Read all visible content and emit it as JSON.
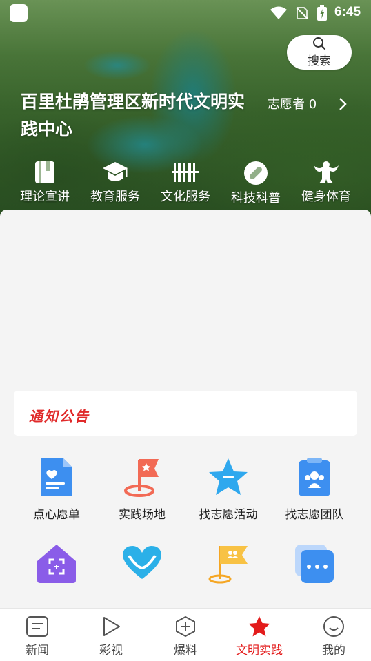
{
  "status_bar": {
    "time": "6:45"
  },
  "header": {
    "search_label": "搜索",
    "title": "百里杜鹃管理区新时代文明实践中心",
    "volunteer": "志愿者 0"
  },
  "categories": [
    {
      "label": "理论宣讲",
      "icon": "book-icon"
    },
    {
      "label": "教育服务",
      "icon": "graduation-cap-icon"
    },
    {
      "label": "文化服务",
      "icon": "barcode-icon"
    },
    {
      "label": "科技科普",
      "icon": "science-icon"
    },
    {
      "label": "健身体育",
      "icon": "fitness-icon"
    }
  ],
  "notice": {
    "title": "通知公告"
  },
  "services": [
    {
      "label": "点心愿单",
      "icon": "wish-list-icon"
    },
    {
      "label": "实践场地",
      "icon": "location-flag-icon"
    },
    {
      "label": "找志愿活动",
      "icon": "star-activity-icon"
    },
    {
      "label": "找志愿团队",
      "icon": "team-icon"
    },
    {
      "label": "",
      "icon": "home-scan-icon"
    },
    {
      "label": "",
      "icon": "heart-icon"
    },
    {
      "label": "",
      "icon": "team-flag-icon"
    },
    {
      "label": "",
      "icon": "more-icon"
    }
  ],
  "bottom_nav": [
    {
      "label": "新闻",
      "icon": "news-icon"
    },
    {
      "label": "彩视",
      "icon": "play-icon"
    },
    {
      "label": "爆料",
      "icon": "add-icon"
    },
    {
      "label": "文明实践",
      "icon": "star-icon",
      "active": true
    },
    {
      "label": "我的",
      "icon": "smile-icon"
    }
  ],
  "colors": {
    "accent": "#e31b1b",
    "hero_text": "#ffffff",
    "service_blue": "#3d8ff0"
  }
}
